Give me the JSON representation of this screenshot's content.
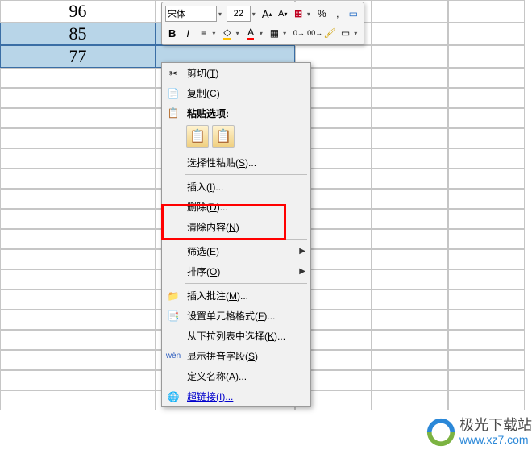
{
  "sheet": {
    "rows": [
      {
        "cells": [
          "96",
          "",
          "",
          "",
          "",
          ""
        ],
        "selected": [
          false,
          false,
          false,
          false,
          false,
          false
        ]
      },
      {
        "cells": [
          "85",
          "",
          "",
          "",
          "",
          ""
        ],
        "selected": [
          true,
          true,
          false,
          false,
          false,
          false
        ]
      },
      {
        "cells": [
          "77",
          "",
          "",
          "",
          "",
          ""
        ],
        "selected": [
          true,
          true,
          false,
          false,
          false,
          false
        ]
      }
    ]
  },
  "toolbar": {
    "font_name": "宋体",
    "font_size": "22",
    "increase_font": "A",
    "decrease_font": "A",
    "percent": "%",
    "comma": ",",
    "bold": "B",
    "italic": "I",
    "align": "≡",
    "fill_a": "A",
    "font_a": "A",
    "border": "▦",
    "inc_dec": ".0",
    "dec_dec": ".00",
    "format_painter": "✎"
  },
  "context_menu": {
    "cut": {
      "label": "剪切",
      "key": "T"
    },
    "copy": {
      "label": "复制",
      "key": "C"
    },
    "paste_title": "粘贴选项:",
    "paste_special": {
      "label": "选择性粘贴",
      "key": "S",
      "ellipsis": "..."
    },
    "insert": {
      "label": "插入",
      "key": "I",
      "ellipsis": "..."
    },
    "delete": {
      "label": "删除",
      "key": "D",
      "ellipsis": "..."
    },
    "clear": {
      "label": "清除内容",
      "key": "N"
    },
    "filter": {
      "label": "筛选",
      "key": "E"
    },
    "sort": {
      "label": "排序",
      "key": "O"
    },
    "comment": {
      "label": "插入批注",
      "key": "M",
      "ellipsis": "..."
    },
    "format_cells": {
      "label": "设置单元格格式",
      "key": "F",
      "ellipsis": "..."
    },
    "dropdown_pick": {
      "label": "从下拉列表中选择",
      "key": "K",
      "ellipsis": "..."
    },
    "phonetic": {
      "label": "显示拼音字段",
      "key": "S"
    },
    "define_name": {
      "label": "定义名称",
      "key": "A",
      "ellipsis": "..."
    },
    "hyperlink": {
      "label": "超链接",
      "key": "I",
      "ellipsis": "..."
    }
  },
  "watermark": {
    "text1": "极光下载站",
    "text2": "www.xz7.com"
  }
}
